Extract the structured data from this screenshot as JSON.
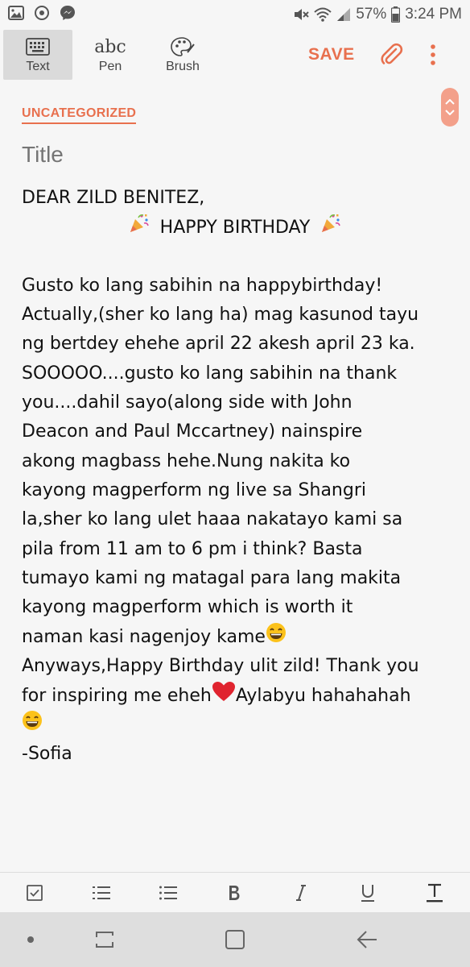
{
  "status_bar": {
    "battery_percent": "57%",
    "time": "3:24 PM"
  },
  "toolbar": {
    "modes": [
      {
        "label": "Text",
        "icon": "keyboard-icon"
      },
      {
        "label": "Pen",
        "icon": "abc-icon",
        "glyph": "abc"
      },
      {
        "label": "Brush",
        "icon": "palette-icon"
      }
    ],
    "active_mode": "Text",
    "save_label": "SAVE"
  },
  "note": {
    "category": "UNCATEGORIZED",
    "title_placeholder": "Title",
    "lines": [
      "DEAR ZILD BENITEZ,",
      "HAPPY BIRTHDAY",
      "",
      "Gusto ko lang sabihin na happybirthday!",
      "Actually,(sher ko lang ha) mag kasunod tayu",
      "ng bertdey ehehe april 22 akesh april 23 ka.",
      "SOOOOO....gusto ko lang sabihin na thank",
      "you....dahil sayo(along side with John",
      "Deacon and Paul Mccartney) nainspire",
      "akong magbass hehe.Nung nakita ko",
      "kayong magperform ng live sa Shangri",
      "la,sher ko lang ulet haaa nakatayo kami sa",
      "pila from 11 am to 6 pm i think? Basta",
      "tumayo kami ng matagal para lang makita",
      "kayong magperform which is worth it",
      "naman kasi nagenjoy kame",
      "Anyways,Happy Birthday ulit zild! Thank you",
      "for inspiring me eheh",
      "Aylabyu hahahahah",
      "",
      "-Sofia"
    ]
  },
  "colors": {
    "accent": "#e8704e",
    "placeholder": "#b8b8b8",
    "nav_bg": "#dedede"
  }
}
